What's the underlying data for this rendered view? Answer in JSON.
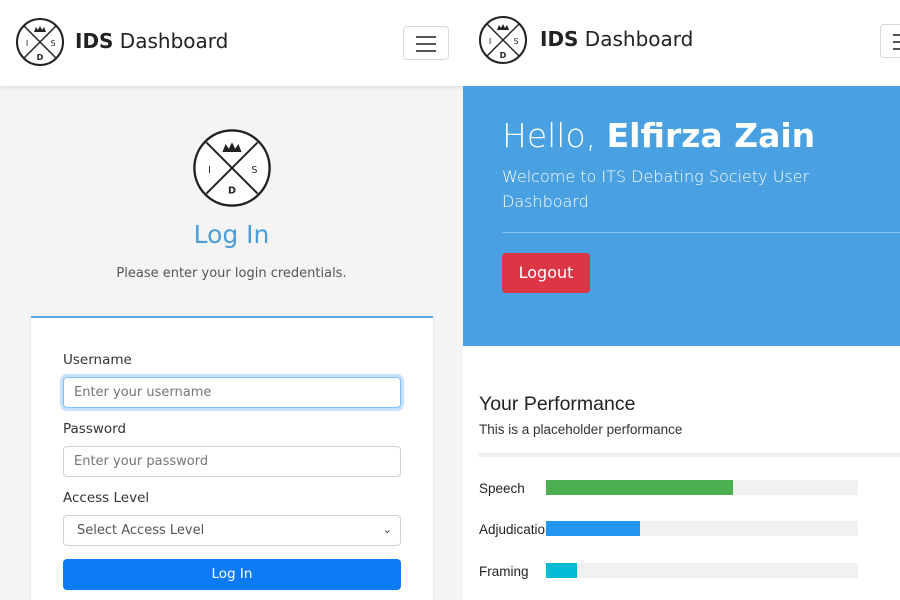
{
  "left_window": {
    "brand": {
      "bold": "IDS",
      "rest": " Dashboard"
    },
    "logo_letters": {
      "left": "I",
      "right": "S",
      "bottom": "D"
    },
    "login": {
      "title": "Log In",
      "subtitle": "Please enter your login credentials.",
      "username_label": "Username",
      "username_placeholder": "Enter your username",
      "password_label": "Password",
      "password_placeholder": "Enter your password",
      "access_label": "Access Level",
      "access_selected": "Select Access Level",
      "submit_label": "Log In"
    }
  },
  "right_window": {
    "brand": {
      "bold": "IDS",
      "rest": " Dashboard"
    },
    "hero": {
      "greeting": "Hello, ",
      "user_name": "Elfirza Zain",
      "welcome": "Welcome to ITS Debating Society User Dashboard",
      "logout_label": "Logout"
    },
    "performance": {
      "title": "Your Performance",
      "subtitle": "This is a placeholder performance",
      "skills": [
        {
          "label": "Speech",
          "fraction": 0.6,
          "color": "#4caf50"
        },
        {
          "label": "Adjudication",
          "fraction": 0.3,
          "color": "#2196f3"
        },
        {
          "label": "Framing",
          "fraction": 0.1,
          "color": "#00bcd4"
        }
      ]
    }
  },
  "colors": {
    "accent_blue": "#4aa1e2",
    "primary_button": "#0d7bf5",
    "danger_button": "#dc3545"
  },
  "icons": [
    "ids-logo-icon",
    "hamburger-menu-icon",
    "chevron-down-icon"
  ]
}
